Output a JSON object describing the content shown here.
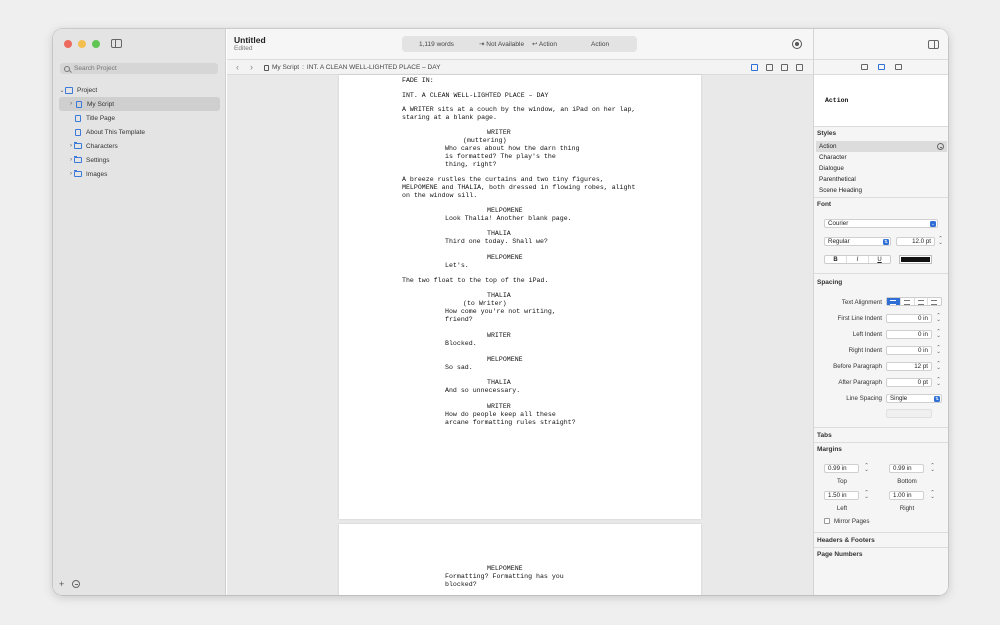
{
  "toolbar": {
    "title": "Untitled",
    "subtitle": "Edited",
    "word_count": "1,119 words",
    "tab_behavior": "⇥ Not Available",
    "return_behavior": "↩ Action",
    "current_style": "Action"
  },
  "sidebar": {
    "search_placeholder": "Search Project",
    "items": [
      {
        "label": "Project",
        "level": 0
      },
      {
        "label": "My Script",
        "level": 1
      },
      {
        "label": "Title Page",
        "level": 2
      },
      {
        "label": "About This Template",
        "level": 2
      },
      {
        "label": "Characters",
        "level": 1
      },
      {
        "label": "Settings",
        "level": 1
      },
      {
        "label": "Images",
        "level": 1
      }
    ],
    "add_label": "+"
  },
  "pathbar": {
    "crumb_doc": "My Script",
    "crumb_sep": ":",
    "crumb_scene": "INT. A CLEAN WELL-LIGHTED PLACE – DAY"
  },
  "script": {
    "page1": [
      "FADE IN:",
      "INT. A CLEAN WELL-LIGHTED PLACE – DAY",
      "A WRITER sits at a couch by the window, an iPad on her lap,",
      "staring at a blank page.",
      "WRITER",
      "(muttering)",
      "Who cares about how the darn thing",
      "is formatted? The play's the",
      "thing, right?",
      "A breeze rustles the curtains and two tiny figures,",
      "MELPOMENE and THALIA, both dressed in flowing robes, alight",
      "on the window sill.",
      "MELPOMENE",
      "Look Thalia! Another blank page.",
      "THALIA",
      "Third one today. Shall we?",
      "MELPOMENE",
      "Let's.",
      "The two float to the top of the iPad.",
      "THALIA",
      "(to Writer)",
      "How come you're not writing,",
      "friend?",
      "WRITER",
      "Blocked.",
      "MELPOMENE",
      "So sad.",
      "THALIA",
      "And so unnecessary.",
      "WRITER",
      "How do people keep all these",
      "arcane formatting rules straight?"
    ],
    "page2": [
      "MELPOMENE",
      "Formatting? Formatting has you",
      "blocked?"
    ]
  },
  "inspector": {
    "preview": "Action",
    "styles_header": "Styles",
    "styles": [
      "Action",
      "Character",
      "Dialogue",
      "Parenthetical",
      "Scene Heading"
    ],
    "font_header": "Font",
    "font_family": "Courier",
    "font_weight": "Regular",
    "font_size": "12.0 pt",
    "bold": "B",
    "italic": "I",
    "underline": "U",
    "text_color": "#111111",
    "spacing_header": "Spacing",
    "text_alignment_label": "Text Alignment",
    "first_line_indent_label": "First Line Indent",
    "first_line_indent": "0 in",
    "left_indent_label": "Left Indent",
    "left_indent": "0 in",
    "right_indent_label": "Right Indent",
    "right_indent": "0 in",
    "before_paragraph_label": "Before Paragraph",
    "before_paragraph": "12 pt",
    "after_paragraph_label": "After Paragraph",
    "after_paragraph": "0 pt",
    "line_spacing_label": "Line Spacing",
    "line_spacing": "Single",
    "tabs_header": "Tabs",
    "margins_header": "Margins",
    "margin_top": "0.99 in",
    "margin_top_label": "Top",
    "margin_bottom": "0.99 in",
    "margin_bottom_label": "Bottom",
    "margin_left": "1.50 in",
    "margin_left_label": "Left",
    "margin_right": "1.00 in",
    "margin_right_label": "Right",
    "mirror_pages_label": "Mirror Pages",
    "headers_footers_header": "Headers & Footers",
    "page_numbers_header": "Page Numbers"
  }
}
